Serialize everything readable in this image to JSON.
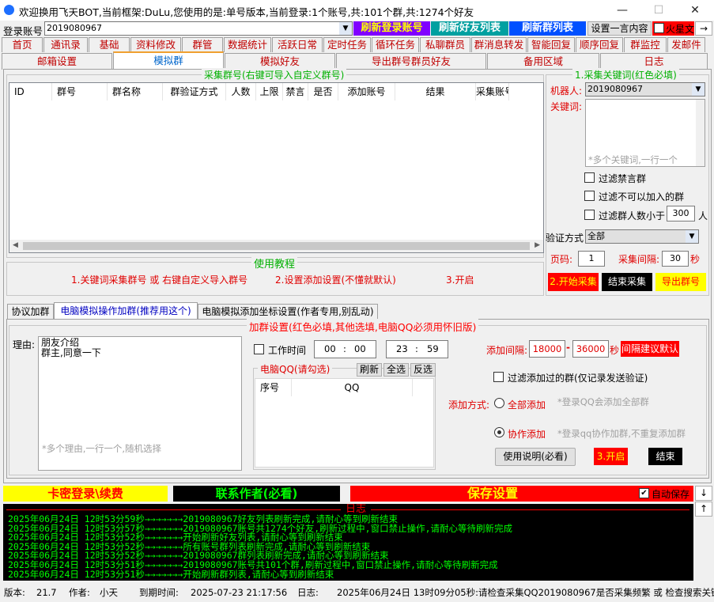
{
  "window": {
    "title": "欢迎换用飞天BOT,当前框架:DuLu,您使用的是:单号版本,当前登录:1个账号,共:101个群,共:1274个好友",
    "min": "—",
    "max": "☐",
    "close": "✕"
  },
  "login": {
    "label": "登录账号",
    "value": "2019080967",
    "refresh_account": "刷新登录账号",
    "refresh_friends": "刷新好友列表",
    "refresh_groups": "刷新群列表",
    "set_one_key": "设置一言内容",
    "fire_label": "火星文",
    "arrow": "→"
  },
  "tabs_row1": [
    "首页",
    "通讯录",
    "基础",
    "资料修改",
    "群管",
    "数据统计",
    "活跃日常",
    "定时任务",
    "循环任务",
    "私聊群员",
    "群消息转发",
    "智能回复",
    "顺序回复",
    "群监控",
    "发邮件"
  ],
  "tabs_row2": [
    "邮箱设置",
    "模拟群",
    "模拟好友",
    "导出群号群员好友",
    "备用区域",
    "日志"
  ],
  "collect": {
    "title": "采集群号(右键可导入自定义群号)",
    "columns": [
      "ID",
      "群号",
      "群名称",
      "群验证方式",
      "人数",
      "上限",
      "禁言",
      "是否",
      "添加账号",
      "结果",
      "采集账号"
    ]
  },
  "keywords": {
    "title": "1.采集关键词(红色必填)",
    "robot_label": "机器人:",
    "robot_value": "2019080967",
    "keyword_label": "关键词:",
    "placeholder": "*多个关键词,一行一个",
    "filter_banned": "过滤禁言群",
    "filter_cannot_join": "过滤不可以加入的群",
    "filter_members_lt": "过滤群人数小于",
    "members_value": "300",
    "members_unit": "人",
    "verify_label": "验证方式",
    "verify_value": "全部",
    "page_label": "页码:",
    "page_value": "1",
    "interval_label": "采集间隔:",
    "interval_value": "30",
    "interval_unit": "秒",
    "start": "2.开始采集",
    "stop": "结束采集",
    "export": "导出群号"
  },
  "tutorial": {
    "title": "使用教程",
    "step1": "1.关键词采集群号 或 右键自定义导入群号",
    "step2": "2.设置添加设置(不懂就默认)",
    "step3": "3.开启"
  },
  "subtabs": [
    "协议加群",
    "电脑模拟操作加群(推荐用这个)",
    "电脑模拟添加坐标设置(作者专用,别乱动)"
  ],
  "join": {
    "title": "加群设置(红色必填,其他选填,电脑QQ必须用怀旧版)",
    "reason_label": "理由:",
    "reason_text": "朋友介绍\n群主,同意一下",
    "reason_placeholder": "*多个理由,一行一个,随机选择",
    "work_time": "工作时间",
    "time_start_h": "00",
    "time_start_m": "00",
    "time_end_h": "23",
    "time_end_m": "59",
    "pc_qq_title": "电脑QQ(请勾选)",
    "btn_refresh": "刷新",
    "btn_select_all": "全选",
    "btn_invert": "反选",
    "col_seq": "序号",
    "col_qq": "QQ",
    "add_interval_label": "添加间隔:",
    "add_min": "18000",
    "add_max": "36000",
    "add_unit": "秒",
    "interval_default": "间隔建议默认",
    "filter_added": "过滤添加过的群(仅记录发送验证)",
    "add_mode_label": "添加方式:",
    "mode_all": "全部添加",
    "mode_all_note": "*登录QQ会添加全部群",
    "mode_coop": "协作添加",
    "mode_coop_note": "*登录qq协作加群,不重复添加群",
    "usage_btn": "使用说明(必看)",
    "open_btn": "3.开启",
    "stop_btn": "结束"
  },
  "bottom_bar": {
    "card_login": "卡密登录\\续费",
    "contact": "联系作者(必看)",
    "save": "保存设置",
    "auto_save": "自动保存",
    "down": "↓",
    "up": "↑"
  },
  "log": {
    "title": "日志",
    "lines": [
      "2025年06月24日 12时53分59秒→→→→→→→2019080967好友列表刷新完成,请耐心等到刷新结束",
      "2025年06月24日 12时53分57秒→→→→→→→2019080967账号共1274个好友,刷新过程中,窗口禁止操作,请耐心等待刷新完成",
      "2025年06月24日 12时53分52秒→→→→→→→开始刷新好友列表,请耐心等到刷新结束",
      "2025年06月24日 12时53分52秒→→→→→→→所有账号群列表刷新完成,请耐心等到刷新结束",
      "2025年06月24日 12时53分52秒→→→→→→→2019080967群列表刷新完成,请耐心等到刷新结束",
      "2025年06月24日 12时53分51秒→→→→→→→2019080967账号共101个群,刷新过程中,窗口禁止操作,请耐心等待刷新完成",
      "2025年06月24日 12时53分51秒→→→→→→→开始刷新群列表,请耐心等到刷新结束"
    ]
  },
  "status": {
    "version_label": "版本:",
    "version": "21.7",
    "author_label": "作者:",
    "author": "小天",
    "expire_label": "到期时间:",
    "expire": "2025-07-23 21:17:56",
    "log_label": "日志:",
    "log_text": "2025年06月24日 13时09分05秒:请检查采集QQ2019080967是否采集频繁 或 检查搜索关键词"
  },
  "colors": {
    "purple": "#8000ff",
    "blue": "#0050ff",
    "red": "#ff0000",
    "yellow": "#ffff00",
    "black": "#000000",
    "green_text": "#00b000"
  }
}
